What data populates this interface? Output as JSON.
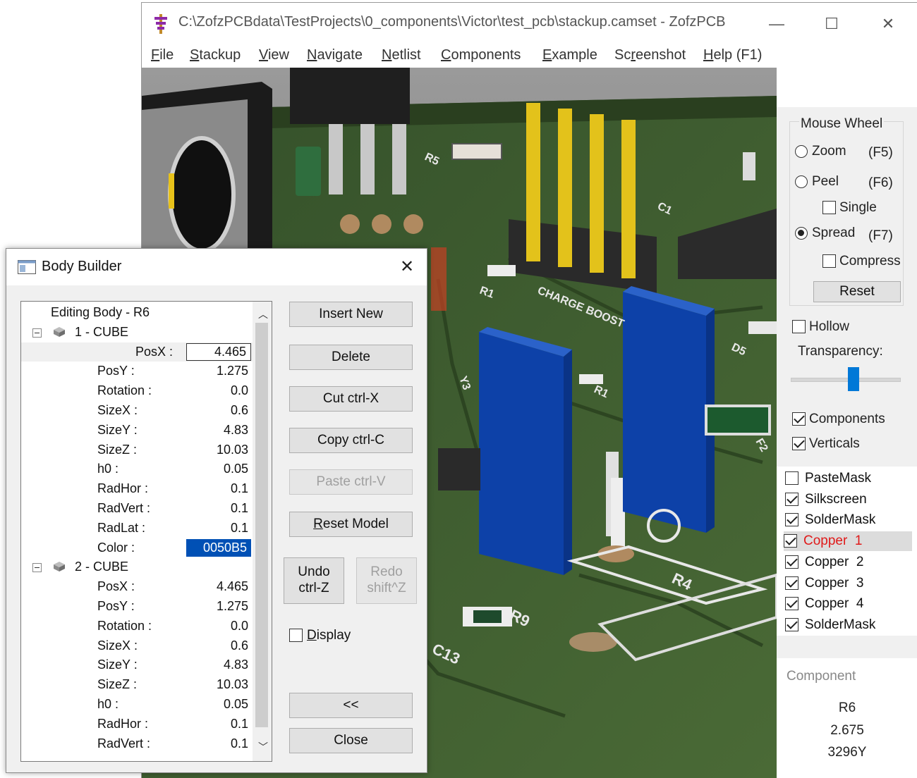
{
  "window": {
    "title": "C:\\ZofzPCBdata\\TestProjects\\0_components\\Victor\\test_pcb\\stackup.camset - ZofzPCB",
    "minimize_glyph": "—",
    "maximize_glyph": "☐",
    "close_glyph": "✕"
  },
  "menu": [
    {
      "pre": "",
      "key": "F",
      "post": "ile"
    },
    {
      "pre": "",
      "key": "S",
      "post": "tackup"
    },
    {
      "pre": "",
      "key": "V",
      "post": "iew"
    },
    {
      "pre": "",
      "key": "N",
      "post": "avigate"
    },
    {
      "pre": "",
      "key": "N",
      "post": "etlist"
    },
    {
      "pre": "",
      "key": "C",
      "post": "omponents"
    },
    {
      "pre": "",
      "key": "E",
      "post": "xample"
    },
    {
      "pre": "Sc",
      "key": "r",
      "post": "eenshot"
    },
    {
      "pre": "",
      "key": "H",
      "post": "elp (F1)"
    }
  ],
  "viewport": {
    "board_color": "#3d5a2b",
    "pcb_labels": [
      "R1",
      "CHARGE BOOST",
      "R4",
      "R9",
      "C13",
      "Y3",
      "D5",
      "C1",
      "R1",
      "F2",
      "R5"
    ]
  },
  "right_panel": {
    "mouse_wheel_title": "Mouse Wheel",
    "zoom": {
      "label": "Zoom",
      "key": "(F5)",
      "selected": false
    },
    "peel": {
      "label": "Peel",
      "key": "(F6)",
      "selected": false
    },
    "single": {
      "label": "Single",
      "checked": false
    },
    "spread": {
      "label": "Spread",
      "key": "(F7)",
      "selected": true
    },
    "compress": {
      "label": "Compress",
      "checked": false
    },
    "reset_label": "Reset",
    "hollow": {
      "label": "Hollow",
      "checked": false
    },
    "transparency_label": "Transparency:",
    "transparency_level": 0.58,
    "components": {
      "label": "Components",
      "checked": true
    },
    "verticals": {
      "label": "Verticals",
      "checked": true
    },
    "layers": [
      {
        "name": "PasteMask",
        "checked": false,
        "highlight": false
      },
      {
        "name": "Silkscreen",
        "checked": true,
        "highlight": false
      },
      {
        "name": "SolderMask",
        "checked": true,
        "highlight": false
      },
      {
        "name": "Copper  1",
        "checked": true,
        "highlight": true
      },
      {
        "name": "Copper  2",
        "checked": true,
        "highlight": false
      },
      {
        "name": "Copper  3",
        "checked": true,
        "highlight": false
      },
      {
        "name": "Copper  4",
        "checked": true,
        "highlight": false
      },
      {
        "name": "SolderMask",
        "checked": true,
        "highlight": false
      }
    ],
    "component_title": "Component",
    "component_name": "R6",
    "component_value": "2.675",
    "component_type": "3296Y"
  },
  "dialog": {
    "title": "Body Builder",
    "close_glyph": "✕",
    "tree_header": "Editing Body - R6",
    "bodies": [
      {
        "name": "1 - CUBE",
        "props": [
          {
            "label": "PosX :",
            "value": "4.465",
            "editing": true
          },
          {
            "label": "PosY :",
            "value": "1.275"
          },
          {
            "label": "Rotation :",
            "value": "0.0"
          },
          {
            "label": "SizeX :",
            "value": "0.6"
          },
          {
            "label": "SizeY :",
            "value": "4.83"
          },
          {
            "label": "SizeZ :",
            "value": "10.03"
          },
          {
            "label": "h0 :",
            "value": "0.05"
          },
          {
            "label": "RadHor :",
            "value": "0.1"
          },
          {
            "label": "RadVert :",
            "value": "0.1"
          },
          {
            "label": "RadLat :",
            "value": "0.1"
          },
          {
            "label": "Color :",
            "value": "0050B5",
            "color": true
          }
        ]
      },
      {
        "name": "2 - CUBE",
        "props": [
          {
            "label": "PosX :",
            "value": "4.465"
          },
          {
            "label": "PosY :",
            "value": "1.275"
          },
          {
            "label": "Rotation :",
            "value": "0.0"
          },
          {
            "label": "SizeX :",
            "value": "0.6"
          },
          {
            "label": "SizeY :",
            "value": "4.83"
          },
          {
            "label": "SizeZ :",
            "value": "10.03"
          },
          {
            "label": "h0 :",
            "value": "0.05"
          },
          {
            "label": "RadHor :",
            "value": "0.1"
          },
          {
            "label": "RadVert :",
            "value": "0.1"
          }
        ]
      }
    ],
    "buttons": {
      "insert_new": "Insert New",
      "delete": "Delete",
      "cut": "Cut  ctrl-X",
      "copy": "Copy  ctrl-C",
      "paste": "Paste  ctrl-V",
      "reset_model": "Reset Model",
      "undo_line1": "Undo",
      "undo_line2": "ctrl-Z",
      "redo_line1": "Redo",
      "redo_line2": "shift^Z",
      "display": "Display",
      "collapse": "<<",
      "close": "Close"
    },
    "display_checked": false,
    "selection_color": "#0050B5"
  }
}
